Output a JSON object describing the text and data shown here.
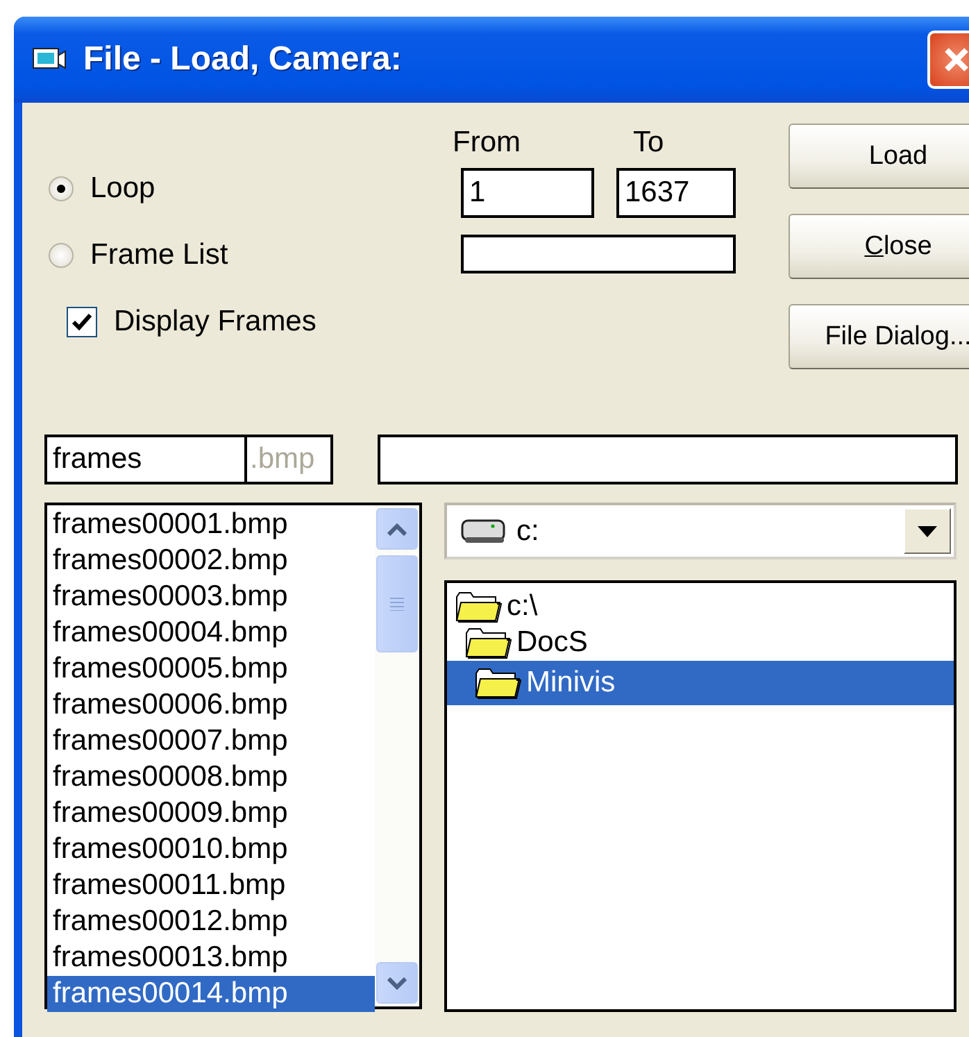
{
  "window": {
    "title": "File - Load, Camera:"
  },
  "range": {
    "from_label": "From",
    "to_label": "To",
    "from": "1",
    "to": "1637"
  },
  "modes": [
    {
      "label": "Loop",
      "selected": true
    },
    {
      "label": "Frame List",
      "selected": false
    }
  ],
  "display_frames": {
    "label": "Display Frames",
    "checked": true
  },
  "buttons": [
    {
      "label": "Load",
      "mnemonic": false
    },
    {
      "label": "Close",
      "mnemonic": true
    },
    {
      "label": "File Dialog...",
      "mnemonic": false
    }
  ],
  "filename": {
    "value": "frames",
    "extension": ".bmp"
  },
  "files": [
    {
      "name": "frames00001.bmp",
      "selected": false
    },
    {
      "name": "frames00002.bmp",
      "selected": false
    },
    {
      "name": "frames00003.bmp",
      "selected": false
    },
    {
      "name": "frames00004.bmp",
      "selected": false
    },
    {
      "name": "frames00005.bmp",
      "selected": false
    },
    {
      "name": "frames00006.bmp",
      "selected": false
    },
    {
      "name": "frames00007.bmp",
      "selected": false
    },
    {
      "name": "frames00008.bmp",
      "selected": false
    },
    {
      "name": "frames00009.bmp",
      "selected": false
    },
    {
      "name": "frames00010.bmp",
      "selected": false
    },
    {
      "name": "frames00011.bmp",
      "selected": false
    },
    {
      "name": "frames00012.bmp",
      "selected": false
    },
    {
      "name": "frames00013.bmp",
      "selected": false
    },
    {
      "name": "frames00014.bmp",
      "selected": true
    }
  ],
  "drive": {
    "value": "c:"
  },
  "folders": [
    {
      "name": "c:\\",
      "selected": false,
      "children": [
        {
          "name": "DocS",
          "selected": false,
          "children": [
            {
              "name": "Minivis",
              "selected": true
            }
          ]
        }
      ]
    }
  ]
}
